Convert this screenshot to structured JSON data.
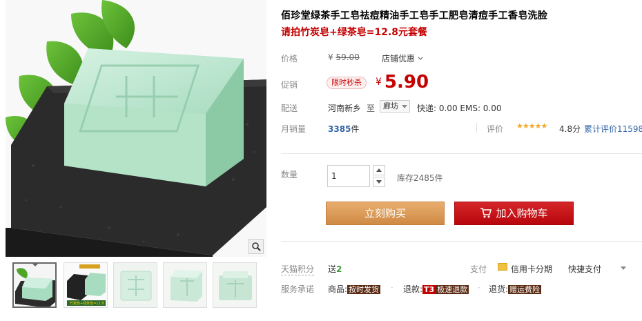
{
  "product": {
    "title": "佰珍堂绿茶手工皂祛痘精油手工皂手工肥皂清痘手工香皂洗脸",
    "subtitle": "请拍竹炭皂+绿茶皂=12.8元套餐"
  },
  "price": {
    "label": "价格",
    "currency": "¥",
    "original": "59.00",
    "store_promo": "店铺优惠"
  },
  "promo": {
    "label": "促销",
    "badge": "限时秒杀",
    "currency": "¥",
    "price": "5.90"
  },
  "shipping": {
    "label": "配送",
    "from": "河南新乡",
    "to_label": "至",
    "to_city": "廊坊",
    "cost": "快递: 0.00 EMS: 0.00"
  },
  "sales": {
    "label": "月销量",
    "count": "3385",
    "unit": "件",
    "rating_label": "评价",
    "stars": "★★★★★",
    "score": "4.8分",
    "review_count": "累计评价11598"
  },
  "quantity": {
    "label": "数量",
    "value": "1",
    "stock": "库存2485件"
  },
  "buttons": {
    "buy_now": "立刻购买",
    "add_cart": "加入购物车"
  },
  "points": {
    "label": "天猫积分",
    "prefix": "送",
    "value": "2"
  },
  "payment": {
    "label": "支付",
    "credit": "信用卡分期",
    "quick": "快捷支付"
  },
  "service": {
    "label": "服务承诺",
    "item1_prefix": "商品:",
    "item1_tag": "按时发货",
    "item2_prefix": "退款:",
    "item2_t3": "T3",
    "item2_tag": "极速退款",
    "item3_prefix": "退货:",
    "item3_tag": "赠运费险"
  },
  "colors": {
    "price_red": "#c40000",
    "buy_orange": "#d8954f",
    "cart_red": "#c41015",
    "star": "#f5a623"
  },
  "icons": [
    "zoom-icon",
    "cart-icon",
    "credit-card-icon",
    "chevron-down-icon",
    "arrow-up-icon",
    "arrow-down-icon"
  ]
}
